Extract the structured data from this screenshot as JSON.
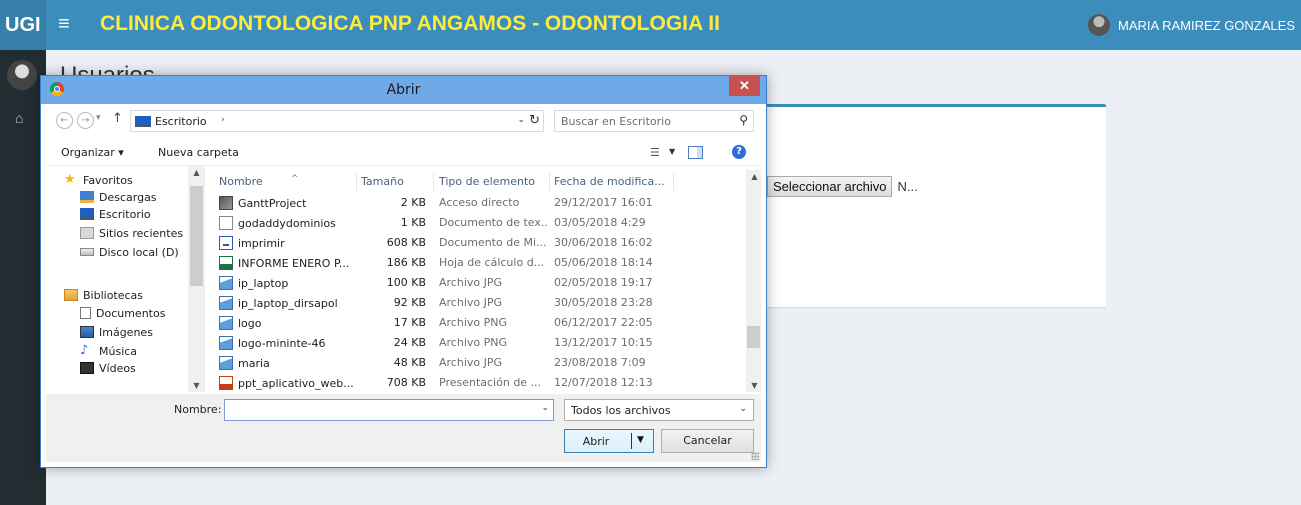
{
  "header": {
    "brand": "UGI",
    "title": "CLINICA ODONTOLOGICA PNP ANGAMOS - ODONTOLOGIA II",
    "user_name": "MARIA RAMIREZ GONZALES"
  },
  "page": {
    "title": "Usuarios",
    "file_button_label": "Seleccionar archivo",
    "file_status": "N..."
  },
  "dialog": {
    "title": "Abrir",
    "close_label": "✕",
    "address": {
      "location": "Escritorio",
      "search_placeholder": "Buscar en Escritorio"
    },
    "toolbar": {
      "organize": "Organizar ▾",
      "new_folder": "Nueva carpeta"
    },
    "nav": [
      {
        "label": "Favoritos",
        "icon": "star-icon",
        "level": 0
      },
      {
        "label": "Descargas",
        "icon": "downloads-folder-icon",
        "level": 1
      },
      {
        "label": "Escritorio",
        "icon": "desktop-icon",
        "level": 1
      },
      {
        "label": "Sitios recientes",
        "icon": "recent-places-icon",
        "level": 1
      },
      {
        "label": "Disco local (D)",
        "icon": "drive-icon",
        "level": 1
      },
      {
        "label": "Bibliotecas",
        "icon": "libraries-icon",
        "level": 0
      },
      {
        "label": "Documentos",
        "icon": "documents-icon",
        "level": 1
      },
      {
        "label": "Imágenes",
        "icon": "pictures-icon",
        "level": 1
      },
      {
        "label": "Música",
        "icon": "music-icon",
        "level": 1
      },
      {
        "label": "Vídeos",
        "icon": "videos-icon",
        "level": 1
      }
    ],
    "columns": {
      "name": "Nombre",
      "size": "Tamaño",
      "type": "Tipo de elemento",
      "date": "Fecha de modifica..."
    },
    "files": [
      {
        "name": "GanttProject",
        "size": "2 KB",
        "type": "Acceso directo",
        "date": "29/12/2017 16:01",
        "icon": "shortcut"
      },
      {
        "name": "godaddydominios",
        "size": "1 KB",
        "type": "Documento de tex...",
        "date": "03/05/2018 4:29",
        "icon": "text"
      },
      {
        "name": "imprimir",
        "size": "608 KB",
        "type": "Documento de Mi...",
        "date": "30/06/2018 16:02",
        "icon": "word"
      },
      {
        "name": "INFORME ENERO P...",
        "size": "186 KB",
        "type": "Hoja de cálculo d...",
        "date": "05/06/2018 18:14",
        "icon": "excel"
      },
      {
        "name": "ip_laptop",
        "size": "100 KB",
        "type": "Archivo JPG",
        "date": "02/05/2018 19:17",
        "icon": "image"
      },
      {
        "name": "ip_laptop_dirsapol",
        "size": "92 KB",
        "type": "Archivo JPG",
        "date": "30/05/2018 23:28",
        "icon": "image"
      },
      {
        "name": "logo",
        "size": "17 KB",
        "type": "Archivo PNG",
        "date": "06/12/2017 22:05",
        "icon": "image"
      },
      {
        "name": "logo-mininte-46",
        "size": "24 KB",
        "type": "Archivo PNG",
        "date": "13/12/2017 10:15",
        "icon": "image"
      },
      {
        "name": "maria",
        "size": "48 KB",
        "type": "Archivo JPG",
        "date": "23/08/2018 7:09",
        "icon": "image"
      },
      {
        "name": "ppt_aplicativo_web...",
        "size": "708 KB",
        "type": "Presentación de ...",
        "date": "12/07/2018 12:13",
        "icon": "ppt"
      }
    ],
    "bottom": {
      "name_label": "Nombre:",
      "name_value": "",
      "file_type": "Todos los archivos",
      "open_label": "Abrir",
      "cancel_label": "Cancelar"
    }
  },
  "colors": {
    "header_bg": "#3c8dbc",
    "title_color": "#ffeb3b",
    "sidebar_bg": "#222d32",
    "dialog_titlebar": "#6fa9e8",
    "close_button": "#c75050"
  }
}
